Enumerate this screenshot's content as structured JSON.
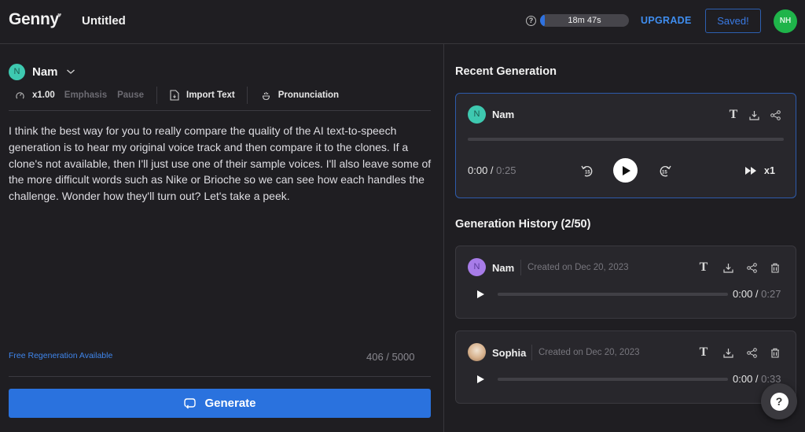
{
  "header": {
    "logo": "Genny",
    "doc_title": "Untitled",
    "usage": {
      "time_left": "18m 47s",
      "fill_percent": 5
    },
    "upgrade_label": "UPGRADE",
    "saved_label": "Saved!",
    "user_initials": "NH"
  },
  "editor": {
    "voice": {
      "initial": "N",
      "name": "Nam"
    },
    "toolbar": {
      "speed": "x1.00",
      "emphasis": "Emphasis",
      "pause": "Pause",
      "import_text": "Import Text",
      "pronunciation": "Pronunciation"
    },
    "script": "I think the best way for you to really compare the quality of the AI text-to-speech generation is to hear my original voice track and then compare it to the clones. If a clone's not available, then I'll just use one of their sample voices. I'll also leave some of the more difficult words such as Nike or Brioche so we can see how each handles the challenge. Wonder how they'll turn out? Let's take a peek.",
    "free_regen": "Free Regeneration Available",
    "char_count": "406 / 5000",
    "generate_label": "Generate"
  },
  "recent": {
    "title": "Recent Generation",
    "voice_initial": "N",
    "voice_name": "Nam",
    "current": "0:00",
    "separator": " / ",
    "duration": "0:25",
    "progress_percent": 0,
    "rewind_seconds": "15",
    "forward_seconds": "15",
    "speed": "x1"
  },
  "history": {
    "title": "Generation History (2/50)",
    "items": [
      {
        "initial": "N",
        "name": "Nam",
        "created": "Created on Dec 20, 2023",
        "current": "0:00",
        "separator": " / ",
        "duration": "0:27",
        "avatar_color": "#a77ce8"
      },
      {
        "initial": "",
        "name": "Sophia",
        "created": "Created on Dec 20, 2023",
        "current": "0:00",
        "separator": " / ",
        "duration": "0:33",
        "avatar_color": "#d8b594"
      }
    ]
  },
  "help_fab": "?",
  "help_small": "?"
}
